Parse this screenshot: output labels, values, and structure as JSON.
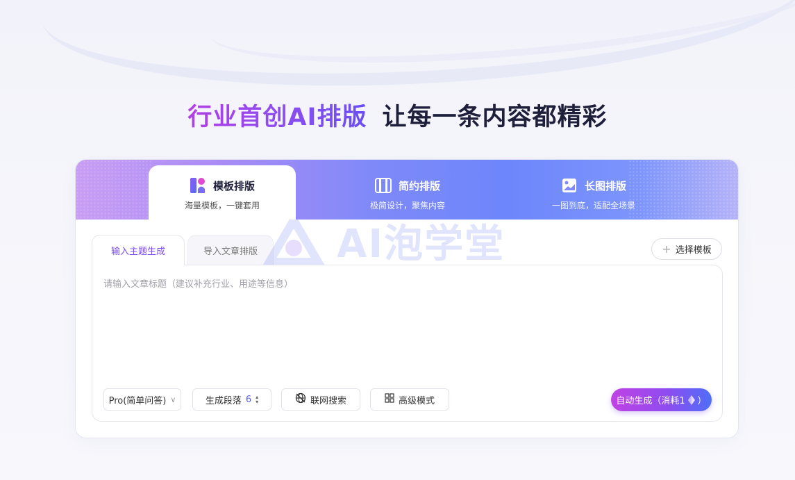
{
  "headline": {
    "highlight": "行业首创AI排版",
    "rest": "让每一条内容都精彩"
  },
  "mode_tabs": [
    {
      "title": "模板排版",
      "subtitle": "海量模板，一键套用",
      "icon": "template-icon",
      "active": true
    },
    {
      "title": "简约排版",
      "subtitle": "极简设计，聚焦内容",
      "icon": "columns-icon",
      "active": false
    },
    {
      "title": "长图排版",
      "subtitle": "一图到底，适配全场景",
      "icon": "long-image-icon",
      "active": false
    }
  ],
  "watermark": "AI泡学堂",
  "input_tabs": {
    "active": "输入主题生成",
    "inactive": "导入文章排版"
  },
  "select_template_label": "选择模板",
  "editor": {
    "placeholder": "请输入文章标题（建议补充行业、用途等信息）",
    "value": ""
  },
  "controls": {
    "model_select": "Pro(简单问答)",
    "paragraph_label": "生成段落",
    "paragraph_count": "6",
    "web_search_label": "联网搜索",
    "advanced_label": "高级模式"
  },
  "generate_button": {
    "label": "自动生成（消耗1",
    "suffix": "）"
  },
  "colors": {
    "accent_purple": "#8e4cf0",
    "accent_magenta": "#c042e4",
    "accent_blue": "#4f6ef8",
    "headline_dark": "#1e1f3a"
  }
}
